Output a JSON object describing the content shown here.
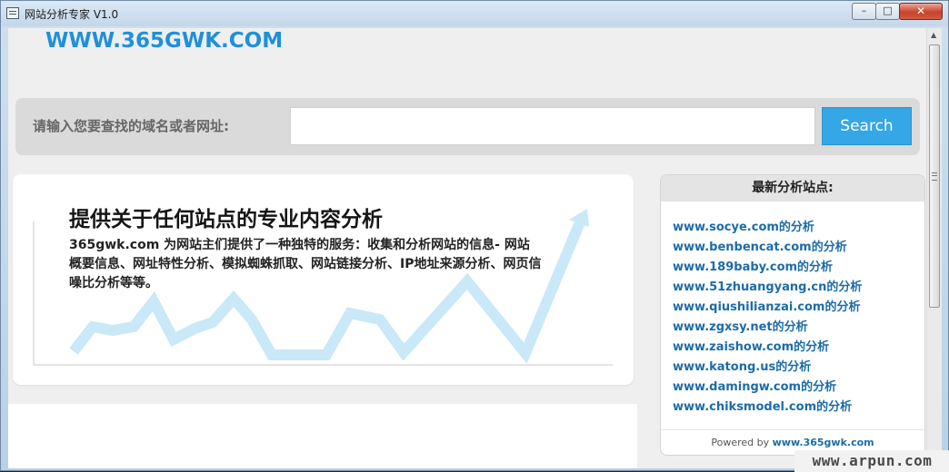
{
  "window": {
    "title": "网站分析专家 V1.0",
    "minimize": "–",
    "maximize": "□",
    "close": "✕"
  },
  "header": {
    "logo": "WWW.365GWK.COM",
    "accent_color": "#1e90dc"
  },
  "search": {
    "label": "请输入您要查找的域名或者网址:",
    "input_value": "",
    "input_placeholder": "",
    "button_label": "Search",
    "button_color": "#35a6e6"
  },
  "feature": {
    "title": "提供关于任何站点的专业内容分析",
    "description": "365gwk.com 为网站主们提供了一种独特的服务：收集和分析网站的信息- 网站概要信息、网址特性分析、模拟蜘蛛抓取、网站链接分析、IP地址来源分析、网页信噪比分析等等。",
    "graphic_color": "#c9e8f8"
  },
  "sidebar": {
    "title": "最新分析站点:",
    "link_color": "#1c6ca8",
    "items": [
      "www.socye.com的分析",
      "www.benbencat.com的分析",
      "www.189baby.com的分析",
      "www.51zhuangyang.cn的分析",
      "www.qiushilianzai.com的分析",
      "www.zgxsy.net的分析",
      "www.zaishow.com的分析",
      "www.katong.us的分析",
      "www.damingw.com的分析",
      "www.chiksmodel.com的分析"
    ],
    "footer_text": "Powered by ",
    "footer_link": "www.365gwk.com"
  },
  "watermark": "www.arpun.com",
  "icons": {
    "app": "window-app-icon",
    "scroll_up": "▲",
    "scroll_down": "▼"
  }
}
